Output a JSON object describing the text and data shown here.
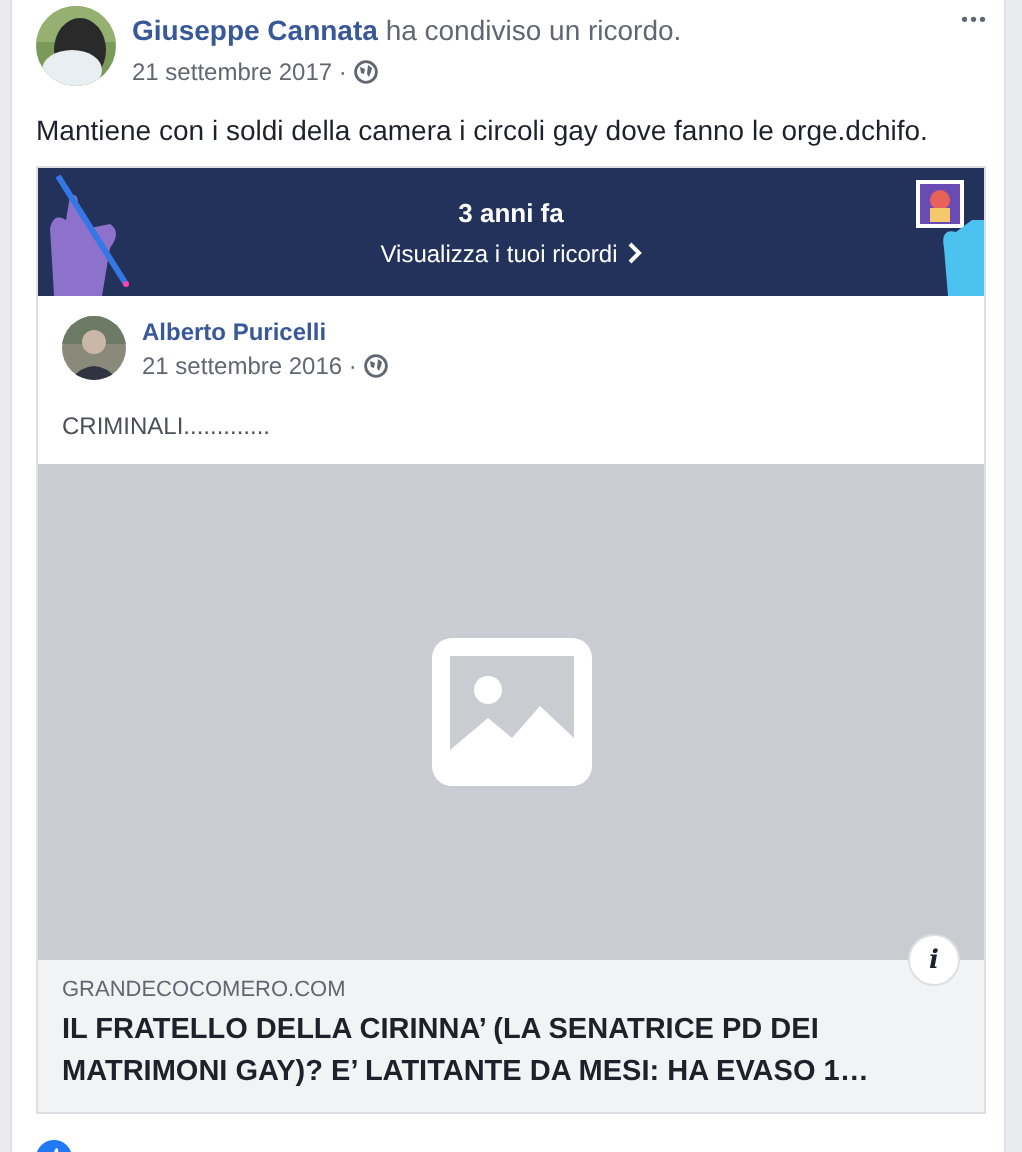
{
  "post": {
    "author": "Giuseppe Cannata",
    "action": "ha condiviso un ricordo.",
    "date": "21 settembre 2017 ·",
    "text": "Mantiene con i soldi della camera i circoli gay dove fanno le orge.dchifo.",
    "more": "•••"
  },
  "memory": {
    "title": "3 anni fa",
    "link": "Visualizza i tuoi ricordi"
  },
  "shared_post": {
    "author": "Alberto Puricelli",
    "date": "21 settembre 2016 ·",
    "text": "CRIMINALI............."
  },
  "link_preview": {
    "domain": "GRANDECOCOMERO.COM",
    "title": "IL FRATELLO DELLA CIRINNA’ (LA SENATRICE PD DEI MATRIMONI GAY)? E’ LATITANTE DA MESI: HA EVASO 1…",
    "info": "i"
  }
}
